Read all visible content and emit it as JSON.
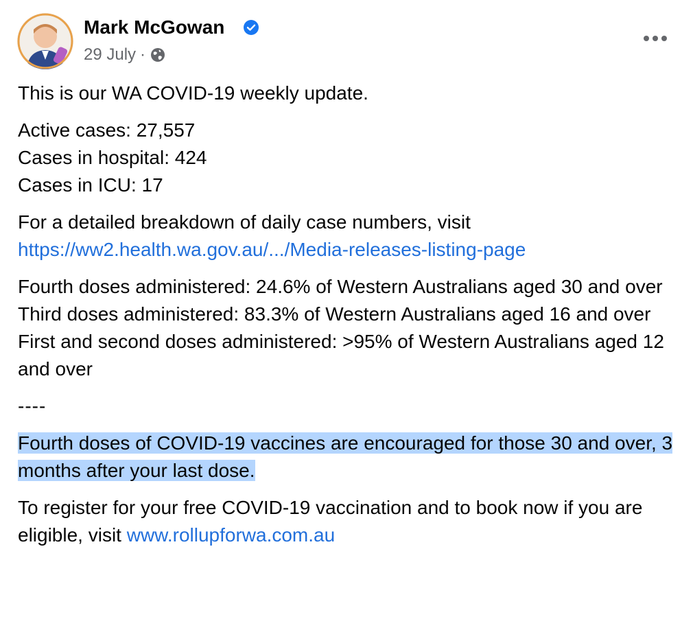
{
  "header": {
    "author_name": "Mark McGowan",
    "date": "29 July",
    "separator": "·",
    "privacy_icon": "globe-icon",
    "verified_icon": "verified-badge-icon",
    "more_icon": "more-options-icon"
  },
  "post": {
    "intro": "This is our WA COVID-19 weekly update.",
    "stats": [
      "Active cases: 27,557",
      "Cases in hospital: 424",
      "Cases in ICU: 17"
    ],
    "breakdown_text": "For a detailed breakdown of daily case numbers, visit",
    "breakdown_link": "https://ww2.health.wa.gov.au/.../Media-releases-listing-page",
    "doses": [
      "Fourth doses administered: 24.6% of Western Australians aged 30 and over",
      "Third doses administered: 83.3% of Western Australians aged 16 and over",
      "First and second doses administered: >95% of Western Australians aged 12 and over"
    ],
    "separator": "----",
    "highlighted_text": "Fourth doses of COVID-19 vaccines are encouraged for those 30 and over, 3 months after your last dose.",
    "register_text": "To register for your free COVID-19 vaccination and to book now if you are eligible, visit ",
    "register_link": "www.rollupforwa.com.au"
  },
  "colors": {
    "link": "#216fdb",
    "highlight": "#b4d5fe",
    "meta": "#65676b",
    "verified": "#1877f2"
  }
}
